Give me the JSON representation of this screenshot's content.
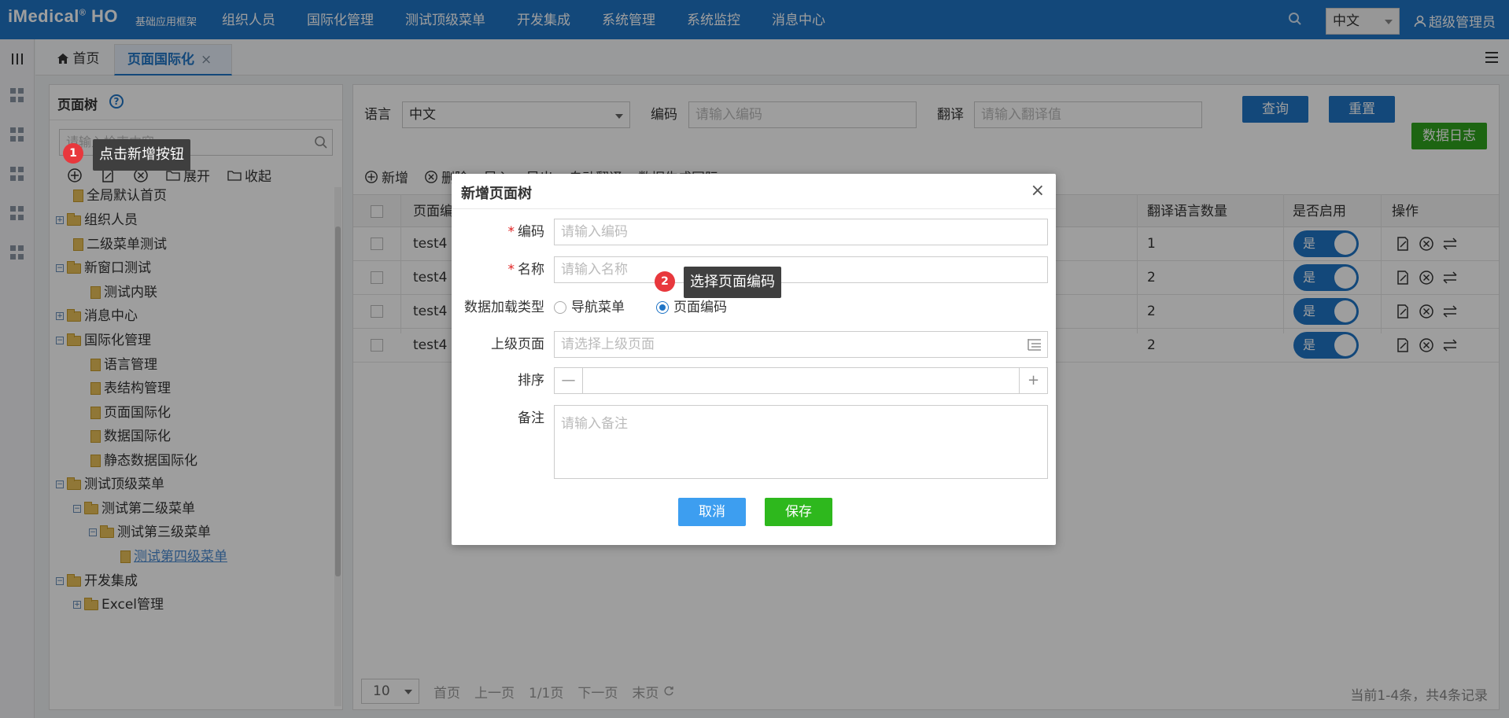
{
  "header": {
    "logo": "iMedical",
    "logo_reg": "®",
    "logo_suffix": "HO",
    "subtitle": "基础应用框架",
    "nav": [
      "组织人员",
      "国际化管理",
      "测试顶级菜单",
      "开发集成",
      "系统管理",
      "系统监控",
      "消息中心"
    ],
    "language": "中文",
    "user": "超级管理员"
  },
  "tabs": {
    "home": "首页",
    "active": "页面国际化",
    "close": "×"
  },
  "tree": {
    "title": "页面树",
    "help": "?",
    "search_placeholder": "请输入检索内容",
    "tools": {
      "expand": "展开",
      "collapse": "收起"
    },
    "nodes": [
      "全局默认首页",
      "组织人员",
      "二级菜单测试",
      "新窗口测试",
      "测试内联",
      "消息中心",
      "国际化管理",
      "语言管理",
      "表结构管理",
      "页面国际化",
      "数据国际化",
      "静态数据国际化",
      "测试顶级菜单",
      "测试第二级菜单",
      "测试第三级菜单",
      "测试第四级菜单",
      "开发集成",
      "Excel管理"
    ]
  },
  "filters": {
    "lang_label": "语言",
    "lang_value": "中文",
    "code_label": "编码",
    "code_placeholder": "请输入编码",
    "trans_label": "翻译",
    "trans_placeholder": "请输入翻译值",
    "query": "查询",
    "reset": "重置",
    "data_log": "数据日志"
  },
  "toolbar": {
    "add": "新增",
    "delete": "删除",
    "import": "导入",
    "export": "导出",
    "auto_translate": "自动翻译",
    "generate": "数据生成国际"
  },
  "table": {
    "headers": {
      "page_code": "页面编",
      "trans_count": "翻译语言数量",
      "enabled": "是否启用",
      "actions": "操作"
    },
    "rows": [
      {
        "code": "test4",
        "count": "1",
        "enabled": "是"
      },
      {
        "code": "test4",
        "count": "2",
        "enabled": "是"
      },
      {
        "code": "test4",
        "count": "2",
        "enabled": "是"
      },
      {
        "code": "test4",
        "count": "2",
        "enabled": "是"
      }
    ]
  },
  "pager": {
    "size": "10",
    "first": "首页",
    "prev": "上一页",
    "page": "1/1页",
    "next": "下一页",
    "last": "末页",
    "summary": "当前1-4条，共4条记录"
  },
  "dialog": {
    "title": "新增页面树",
    "close": "×",
    "code_label": "编码",
    "code_placeholder": "请输入编码",
    "name_label": "名称",
    "name_placeholder": "请输入名称",
    "load_type_label": "数据加载类型",
    "load_type_options": [
      "导航菜单",
      "页面编码"
    ],
    "parent_label": "上级页面",
    "parent_placeholder": "请选择上级页面",
    "sort_label": "排序",
    "minus": "—",
    "plus": "+",
    "remark_label": "备注",
    "remark_placeholder": "请输入备注",
    "cancel": "取消",
    "save": "保存",
    "required_mark": "*"
  },
  "callouts": {
    "step1_num": "1",
    "step1_text": "点击新增按钮",
    "step2_num": "2",
    "step2_text": "选择页面编码"
  },
  "colors": {
    "primary": "#1f74c6",
    "green": "#2fa31d",
    "danger_badge": "#e8383d"
  }
}
